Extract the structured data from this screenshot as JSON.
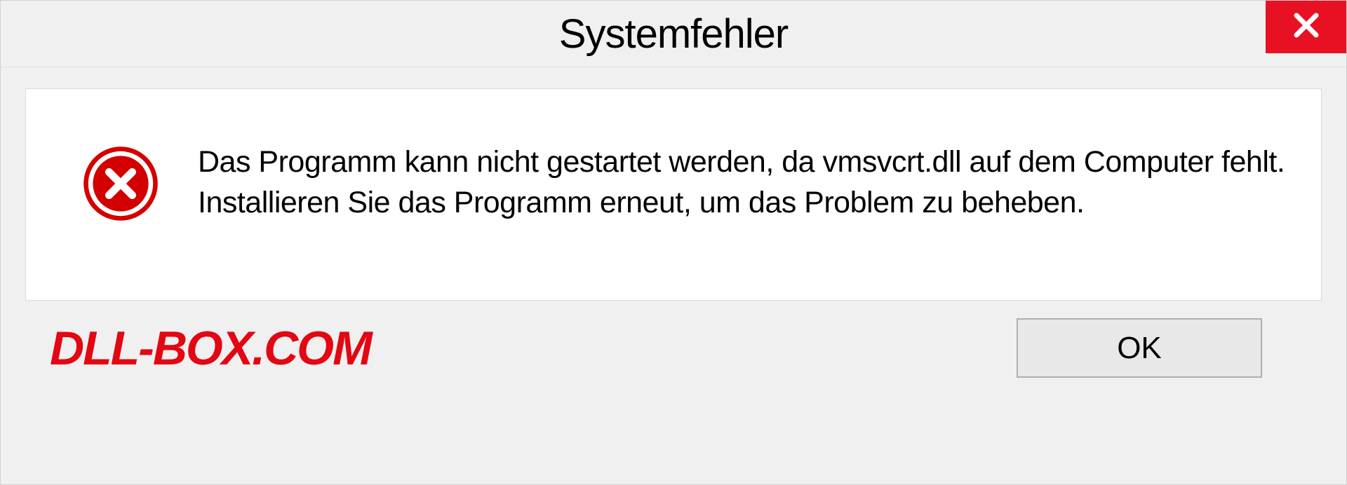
{
  "dialog": {
    "title": "Systemfehler",
    "message": "Das Programm kann nicht gestartet werden, da vmsvcrt.dll auf dem Computer fehlt. Installieren Sie das Programm erneut, um das Problem zu beheben.",
    "ok_label": "OK"
  },
  "watermark": "DLL-BOX.COM",
  "colors": {
    "close_button": "#e81123",
    "error_icon": "#d40000",
    "watermark": "#e30613"
  }
}
